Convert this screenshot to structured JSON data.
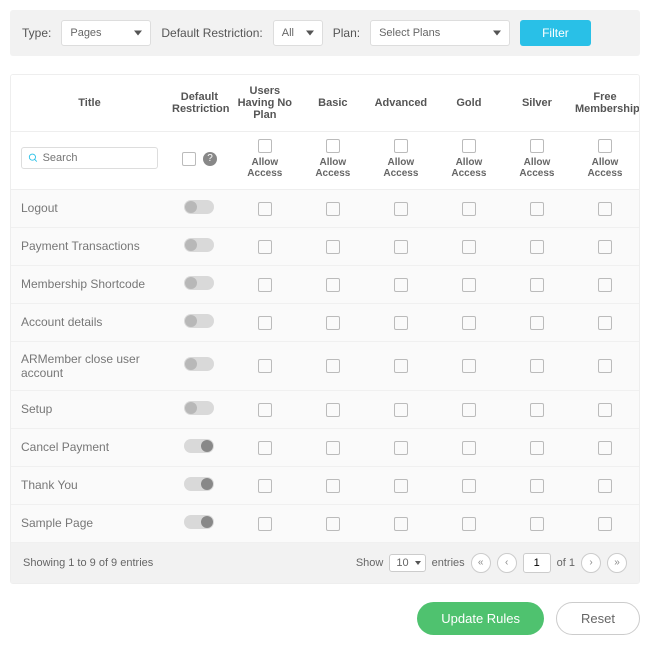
{
  "filter": {
    "type_label": "Type:",
    "type_value": "Pages",
    "restriction_label": "Default Restriction:",
    "restriction_value": "All",
    "plan_label": "Plan:",
    "plan_value": "Select Plans",
    "filter_btn": "Filter"
  },
  "columns": {
    "title": "Title",
    "default_restriction": "Default Restriction",
    "users_no_plan": "Users Having No Plan",
    "plans": [
      "Basic",
      "Advanced",
      "Gold",
      "Silver",
      "Free Membership"
    ]
  },
  "search": {
    "placeholder": "Search"
  },
  "allow_label": "Allow Access",
  "help_glyph": "?",
  "rows": [
    {
      "title": "Logout",
      "restricted": false
    },
    {
      "title": "Payment Transactions",
      "restricted": false
    },
    {
      "title": "Membership Shortcode",
      "restricted": false
    },
    {
      "title": "Account details",
      "restricted": false
    },
    {
      "title": "ARMember close user account",
      "restricted": false
    },
    {
      "title": "Setup",
      "restricted": false
    },
    {
      "title": "Cancel Payment",
      "restricted": true
    },
    {
      "title": "Thank You",
      "restricted": true
    },
    {
      "title": "Sample Page",
      "restricted": true
    }
  ],
  "footer": {
    "showing": "Showing 1 to 9 of 9 entries",
    "show_label": "Show",
    "page_size": "10",
    "entries_label": "entries",
    "page_num": "1",
    "of_label": "of 1"
  },
  "actions": {
    "update": "Update Rules",
    "reset": "Reset"
  }
}
